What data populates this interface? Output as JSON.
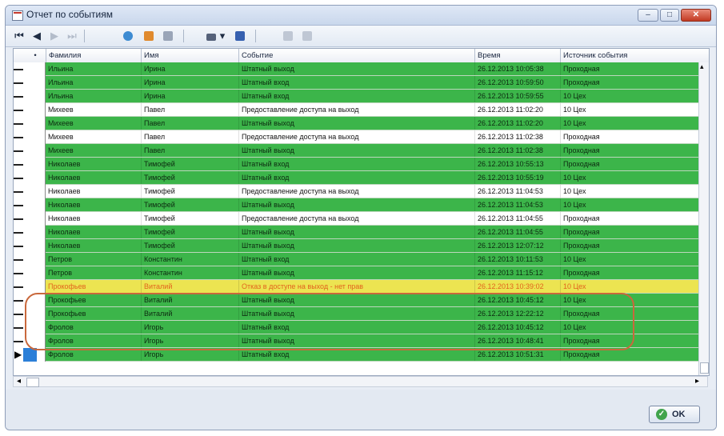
{
  "window": {
    "title": "Отчет по событиям",
    "controls": {
      "minimize": "–",
      "maximize": "□",
      "close": "✕"
    }
  },
  "toolbar": {
    "first": "⏮",
    "prev": "◀",
    "next": "▶",
    "last": "⏭",
    "print_arrow": "▾"
  },
  "grid": {
    "columns": [
      "Фамилия",
      "Имя",
      "Событие",
      "Время",
      "Источник события"
    ],
    "sort_marker": "•",
    "rows": [
      {
        "c": [
          "Ильина",
          "Ирина",
          "Штатный выход",
          "26.12.2013 10:05:38",
          "Проходная"
        ],
        "s": "g"
      },
      {
        "c": [
          "Ильина",
          "Ирина",
          "Штатный вход",
          "26.12.2013 10:59:50",
          "Проходная"
        ],
        "s": "g"
      },
      {
        "c": [
          "Ильина",
          "Ирина",
          "Штатный вход",
          "26.12.2013 10:59:55",
          "10 Цех"
        ],
        "s": "g"
      },
      {
        "c": [
          "Михеев",
          "Павел",
          "Предоставление доступа на выход",
          "26.12.2013 11:02:20",
          "10 Цех"
        ],
        "s": "w"
      },
      {
        "c": [
          "Михеев",
          "Павел",
          "Штатный выход",
          "26.12.2013 11:02:20",
          "10 Цех"
        ],
        "s": "g"
      },
      {
        "c": [
          "Михеев",
          "Павел",
          "Предоставление доступа на выход",
          "26.12.2013 11:02:38",
          "Проходная"
        ],
        "s": "w"
      },
      {
        "c": [
          "Михеев",
          "Павел",
          "Штатный выход",
          "26.12.2013 11:02:38",
          "Проходная"
        ],
        "s": "g"
      },
      {
        "c": [
          "Николаев",
          "Тимофей",
          "Штатный вход",
          "26.12.2013 10:55:13",
          "Проходная"
        ],
        "s": "g"
      },
      {
        "c": [
          "Николаев",
          "Тимофей",
          "Штатный вход",
          "26.12.2013 10:55:19",
          "10 Цех"
        ],
        "s": "g"
      },
      {
        "c": [
          "Николаев",
          "Тимофей",
          "Предоставление доступа на выход",
          "26.12.2013 11:04:53",
          "10 Цех"
        ],
        "s": "w"
      },
      {
        "c": [
          "Николаев",
          "Тимофей",
          "Штатный выход",
          "26.12.2013 11:04:53",
          "10 Цех"
        ],
        "s": "g"
      },
      {
        "c": [
          "Николаев",
          "Тимофей",
          "Предоставление доступа на выход",
          "26.12.2013 11:04:55",
          "Проходная"
        ],
        "s": "w"
      },
      {
        "c": [
          "Николаев",
          "Тимофей",
          "Штатный выход",
          "26.12.2013 11:04:55",
          "Проходная"
        ],
        "s": "g"
      },
      {
        "c": [
          "Николаев",
          "Тимофей",
          "Штатный выход",
          "26.12.2013 12:07:12",
          "Проходная"
        ],
        "s": "g"
      },
      {
        "c": [
          "Петров",
          "Константин",
          "Штатный вход",
          "26.12.2013 10:11:53",
          "10 Цех"
        ],
        "s": "g"
      },
      {
        "c": [
          "Петров",
          "Константин",
          "Штатный выход",
          "26.12.2013 11:15:12",
          "Проходная"
        ],
        "s": "g"
      },
      {
        "c": [
          "Прокофьев",
          "Виталий",
          "Отказ в доступе на выход - нет прав",
          "26.12.2013 10:39:02",
          "10 Цех"
        ],
        "s": "y"
      },
      {
        "c": [
          "Прокофьев",
          "Виталий",
          "Штатный выход",
          "26.12.2013 10:45:12",
          "10 Цех"
        ],
        "s": "g"
      },
      {
        "c": [
          "Прокофьев",
          "Виталий",
          "Штатный выход",
          "26.12.2013 12:22:12",
          "Проходная"
        ],
        "s": "g"
      },
      {
        "c": [
          "Фролов",
          "Игорь",
          "Штатный вход",
          "26.12.2013 10:45:12",
          "10 Цех"
        ],
        "s": "g"
      },
      {
        "c": [
          "Фролов",
          "Игорь",
          "Штатный выход",
          "26.12.2013 10:48:41",
          "Проходная"
        ],
        "s": "g"
      },
      {
        "c": [
          "Фролов",
          "Игорь",
          "Штатный вход",
          "26.12.2013 10:51:31",
          "Проходная"
        ],
        "s": "g",
        "current": true
      }
    ],
    "scroll_up": "▴",
    "scroll_down": "▾",
    "scroll_left": "◂",
    "scroll_right": "▸"
  },
  "footer": {
    "ok_label": "OK",
    "ok_icon": "✓"
  },
  "colors": {
    "green_row": "#3cb54a",
    "white_row": "#ffffff",
    "yellow_row": "#ece451",
    "yellow_text": "#e2641d",
    "annotation": "#c9683c"
  }
}
